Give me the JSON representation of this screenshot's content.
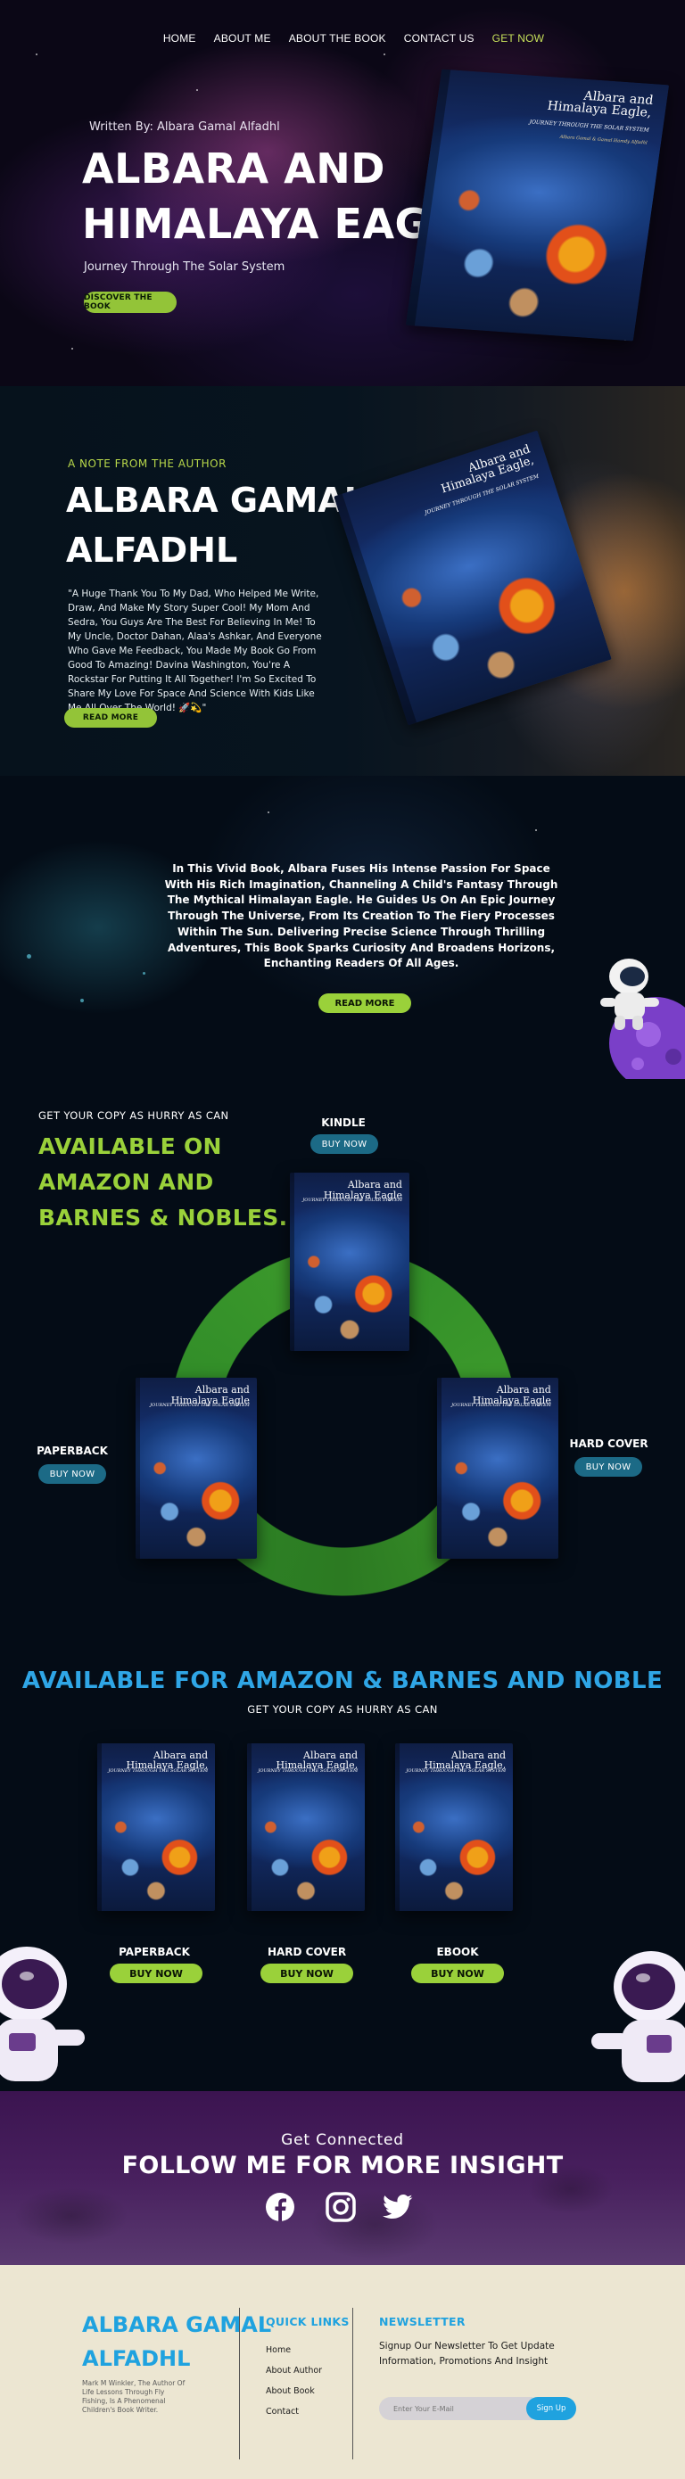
{
  "nav": {
    "items": [
      "HOME",
      "ABOUT ME",
      "ABOUT THE BOOK",
      "CONTACT US",
      "GET NOW"
    ],
    "active_index": 4,
    "active_color": "#c6e05a"
  },
  "hero": {
    "byline": "Written By: Albara Gamal Alfadhl",
    "title_line1": "ALBARA AND",
    "title_line2": "HIMALAYA EAGLE",
    "subtitle": "Journey Through The Solar System",
    "cta": "DISCOVER THE BOOK"
  },
  "book": {
    "title_line1": "Albara and",
    "title_line2": "Himalaya Eagle,",
    "subtitle": "JOURNEY THROUGH THE SOLAR SYSTEM",
    "author": "Albara Gamal & Gamal Hamdy Alfadhl",
    "short_line2": "Himalaya Eagle"
  },
  "author_note": {
    "kicker": "A NOTE FROM THE AUTHOR",
    "name_line1": "ALBARA GAMAL",
    "name_line2": "ALFADHL",
    "text": "\"A Huge Thank You To My Dad, Who Helped Me Write, Draw, And Make My Story Super Cool! My Mom And Sedra, You Guys Are The Best For Believing In Me! To My Uncle, Doctor Dahan, Alaa's Ashkar, And Everyone Who Gave Me Feedback, You Made My Book Go From Good To Amazing! Davina Washington, You're A Rockstar For Putting It All Together! I'm So Excited To Share My Love For Space And Science With Kids Like Me All Over The World! 🚀💫\"",
    "cta": "READ MORE"
  },
  "description": {
    "text": "In This Vivid Book, Albara Fuses His Intense Passion For Space With His Rich Imagination, Channeling A Child's Fantasy Through The Mythical Himalayan Eagle. He Guides Us On An Epic Journey Through The Universe, From Its Creation To The Fiery Processes Within The Sun. Delivering Precise Science Through Thrilling Adventures, This Book Sparks Curiosity And Broadens Horizons, Enchanting Readers Of All Ages.",
    "cta": "READ MORE"
  },
  "availability": {
    "kicker": "GET YOUR COPY AS HURRY AS CAN",
    "title_line1": "AVAILABLE ON",
    "title_line2": "AMAZON AND",
    "title_line3": "BARNES & NOBLES.",
    "formats": [
      {
        "label": "KINDLE",
        "button": "BUY NOW"
      },
      {
        "label": "PAPERBACK",
        "button": "BUY NOW"
      },
      {
        "label": "HARD COVER",
        "button": "BUY NOW"
      }
    ]
  },
  "store": {
    "title": "AVAILABLE FOR AMAZON & BARNES AND NOBLE",
    "subtitle": "GET YOUR COPY AS HURRY AS CAN",
    "items": [
      {
        "label": "PAPERBACK",
        "button": "BUY NOW"
      },
      {
        "label": "HARD COVER",
        "button": "BUY NOW"
      },
      {
        "label": "EBOOK",
        "button": "BUY NOW"
      }
    ]
  },
  "connect": {
    "kicker": "Get Connected",
    "title": "FOLLOW ME FOR MORE INSIGHT",
    "icons": [
      "facebook-icon",
      "instagram-icon",
      "twitter-icon"
    ]
  },
  "footer": {
    "brand_line1": "ALBARA GAMAL",
    "brand_line2": "ALFADHL",
    "tagline": "Mark M Winkler, The Author Of Life Lessons Through Fly Fishing, Is A Phenomenal Children's Book Writer.",
    "quick_links_title": "QUICK LINKS",
    "links": [
      "Home",
      "About Author",
      "About Book",
      "Contact"
    ],
    "newsletter_title": "NEWSLETTER",
    "newsletter_text": "Signup Our Newsletter To Get Update Information, Promotions And Insight",
    "email_placeholder": "Enter Your E-Mail",
    "signup": "Sign Up"
  },
  "colors": {
    "green": "#93c438",
    "teal": "#1c6a86",
    "blue": "#1fa2df",
    "purple": "#48205e",
    "cream": "#ece6d2"
  }
}
